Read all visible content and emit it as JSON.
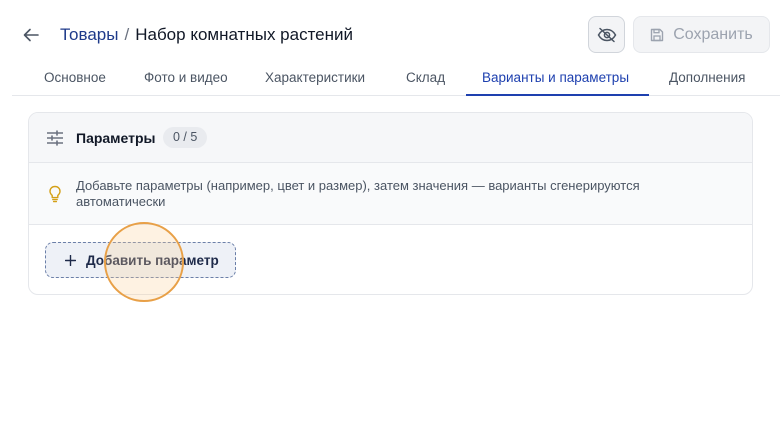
{
  "header": {
    "breadcrumb_parent": "Товары",
    "breadcrumb_separator": "/",
    "breadcrumb_current": "Набор комнатных растений",
    "save_label": "Сохранить"
  },
  "tabs": [
    {
      "label": "Основное",
      "active": false
    },
    {
      "label": "Фото и видео",
      "active": false
    },
    {
      "label": "Характеристики",
      "active": false
    },
    {
      "label": "Склад",
      "active": false
    },
    {
      "label": "Варианты и параметры",
      "active": true
    },
    {
      "label": "Дополнения",
      "active": false
    }
  ],
  "params_card": {
    "title": "Параметры",
    "count": "0 / 5",
    "hint": "Добавьте параметры (например, цвет и размер), затем значения — варианты сгенерируются автоматически",
    "add_label": "Добавить параметр"
  },
  "icons": {
    "back": "arrow-left-icon",
    "visibility": "eye-off-icon",
    "save": "floppy-disk-icon",
    "params": "sliders-icon",
    "hint": "lightbulb-icon",
    "add": "plus-icon"
  },
  "colors": {
    "accent": "#1e40af",
    "hint_bulb": "#d4a017",
    "click_indicator": "#e8a047"
  }
}
